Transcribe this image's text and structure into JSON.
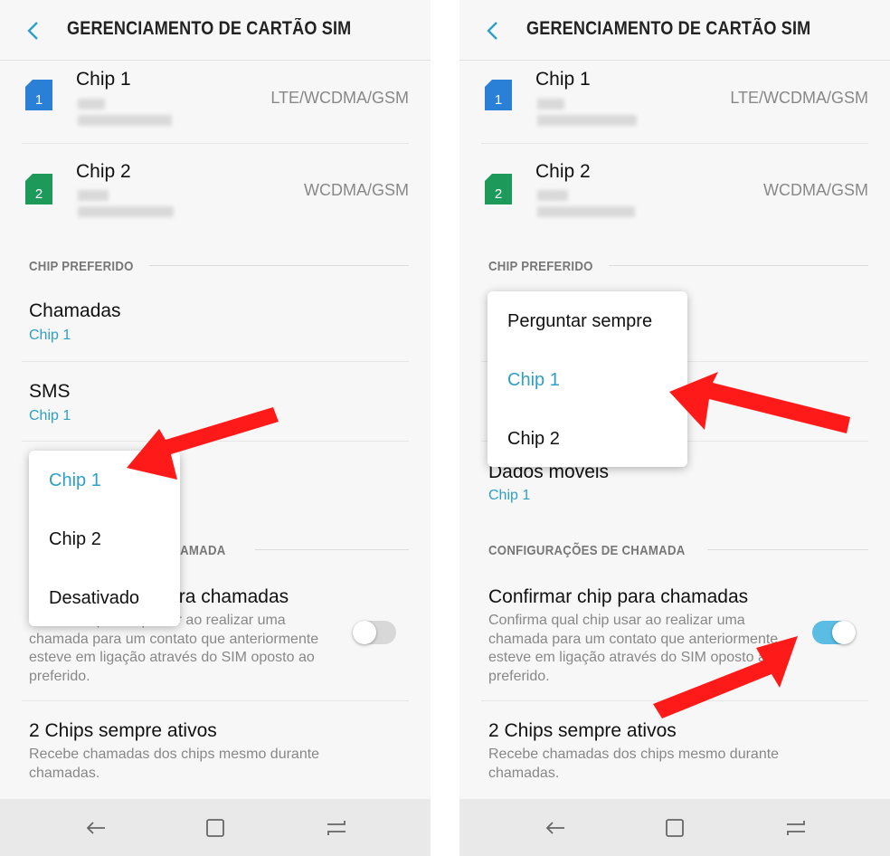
{
  "screens": [
    {
      "header": {
        "title": "GERENCIAMENTO DE CARTÃO SIM"
      },
      "sims": [
        {
          "name": "Chip 1",
          "network": "LTE/WCDMA/GSM",
          "number": "1",
          "color": "#2a7fd6"
        },
        {
          "name": "Chip 2",
          "network": "WCDMA/GSM",
          "number": "2",
          "color": "#1d9a5a"
        }
      ],
      "preferred_section": "CHIP PREFERIDO",
      "calls": {
        "title": "Chamadas",
        "value": "Chip 1"
      },
      "sms": {
        "title": "SMS",
        "value": "Chip 1"
      },
      "call_section": "CONFIGURAÇÕES DE CHAMADA",
      "confirm": {
        "title": "Confirmar chip para chamadas",
        "desc": "Confirma qual chip usar ao realizar uma chamada para um contato que anteriormente esteve em ligação através do SIM oposto ao preferido.",
        "toggle_on": false
      },
      "always_on": {
        "title": "2 Chips sempre ativos",
        "desc": "Recebe chamadas dos chips mesmo durante chamadas."
      },
      "popup": {
        "options": [
          "Chip 1",
          "Chip 2",
          "Desativado"
        ],
        "selected_index": 0
      }
    },
    {
      "header": {
        "title": "GERENCIAMENTO DE CARTÃO SIM"
      },
      "sims": [
        {
          "name": "Chip 1",
          "network": "LTE/WCDMA/GSM",
          "number": "1",
          "color": "#2a7fd6"
        },
        {
          "name": "Chip 2",
          "network": "WCDMA/GSM",
          "number": "2",
          "color": "#1d9a5a"
        }
      ],
      "preferred_section": "CHIP PREFERIDO",
      "mobile_data": {
        "title": "Dados móveis",
        "value": "Chip 1"
      },
      "call_section": "CONFIGURAÇÕES DE CHAMADA",
      "confirm": {
        "title": "Confirmar chip para chamadas",
        "desc": "Confirma qual chip usar ao realizar uma chamada para um contato que anteriormente esteve em ligação através do SIM oposto ao preferido.",
        "toggle_on": true
      },
      "always_on": {
        "title": "2 Chips sempre ativos",
        "desc": "Recebe chamadas dos chips mesmo durante chamadas."
      },
      "popup": {
        "options": [
          "Perguntar sempre",
          "Chip 1",
          "Chip 2"
        ],
        "selected_index": 1
      }
    }
  ],
  "icons": {
    "back": "chevron-left-icon",
    "sim": "sim-card-icon",
    "nav_back": "back-arrow-icon",
    "nav_home": "home-square-icon",
    "nav_recent": "recent-apps-icon",
    "annotation": "red-arrow-annotation"
  },
  "colors": {
    "accent": "#2f9fc5",
    "toggle_on": "#5bbde3",
    "toggle_off": "#d8d8d8",
    "annotation": "#ff1a1a"
  }
}
